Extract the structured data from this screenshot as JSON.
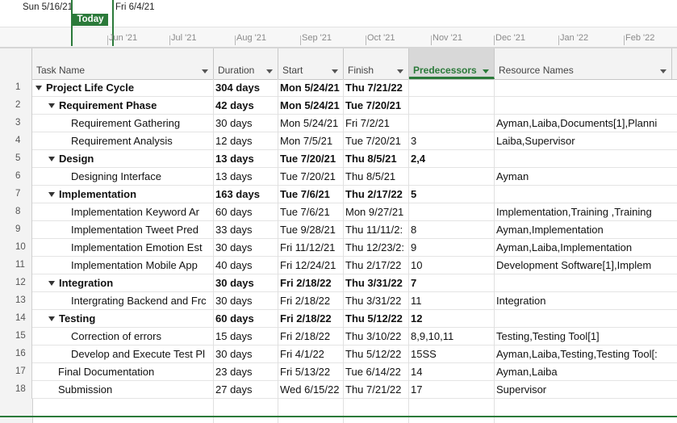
{
  "timeline": {
    "start_label": "Sun 5/16/21",
    "end_label": "Fri 6/4/21",
    "today_label": "Today",
    "months": [
      "Jun '21",
      "Jul '21",
      "Aug '21",
      "Sep '21",
      "Oct '21",
      "Nov '21",
      "Dec '21",
      "Jan '22",
      "Feb '22"
    ]
  },
  "columns": {
    "task_name": "Task Name",
    "duration": "Duration",
    "start": "Start",
    "finish": "Finish",
    "predecessors": "Predecessors",
    "resource_names": "Resource Names"
  },
  "accent_color": "#2b7a3a",
  "rows": [
    {
      "id": "1",
      "name": "Project Life Cycle",
      "level": 0,
      "summary": true,
      "duration": "304 days",
      "start": "Mon 5/24/21",
      "finish": "Thu 7/21/22",
      "pred": "",
      "res": ""
    },
    {
      "id": "2",
      "name": "Requirement Phase",
      "level": 1,
      "summary": true,
      "duration": "42 days",
      "start": "Mon 5/24/21",
      "finish": "Tue 7/20/21",
      "pred": "",
      "res": ""
    },
    {
      "id": "3",
      "name": "Requirement Gathering",
      "level": 2,
      "summary": false,
      "duration": "30 days",
      "start": "Mon 5/24/21",
      "finish": "Fri 7/2/21",
      "pred": "",
      "res": "Ayman,Laiba,Documents[1],Planni"
    },
    {
      "id": "4",
      "name": "Requirement Analysis",
      "level": 2,
      "summary": false,
      "duration": "12 days",
      "start": "Mon 7/5/21",
      "finish": "Tue 7/20/21",
      "pred": "3",
      "res": "Laiba,Supervisor"
    },
    {
      "id": "5",
      "name": "Design",
      "level": 1,
      "summary": true,
      "duration": "13 days",
      "start": "Tue 7/20/21",
      "finish": "Thu 8/5/21",
      "pred": "2,4",
      "res": ""
    },
    {
      "id": "6",
      "name": "Designing Interface",
      "level": 2,
      "summary": false,
      "duration": "13 days",
      "start": "Tue 7/20/21",
      "finish": "Thu 8/5/21",
      "pred": "",
      "res": "Ayman"
    },
    {
      "id": "7",
      "name": "Implementation",
      "level": 1,
      "summary": true,
      "duration": "163 days",
      "start": "Tue 7/6/21",
      "finish": "Thu 2/17/22",
      "pred": "5",
      "res": ""
    },
    {
      "id": "8",
      "name": "Implementation Keyword Ar",
      "level": 2,
      "summary": false,
      "duration": "60 days",
      "start": "Tue 7/6/21",
      "finish": "Mon 9/27/21",
      "pred": "",
      "res": "Implementation,Training ,Training"
    },
    {
      "id": "9",
      "name": "Implementation Tweet Pred",
      "level": 2,
      "summary": false,
      "duration": "33 days",
      "start": "Tue 9/28/21",
      "finish": "Thu 11/11/2:",
      "pred": "8",
      "res": "Ayman,Implementation"
    },
    {
      "id": "10",
      "name": "Implementation Emotion Est",
      "level": 2,
      "summary": false,
      "duration": "30 days",
      "start": "Fri 11/12/21",
      "finish": "Thu 12/23/2:",
      "pred": "9",
      "res": "Ayman,Laiba,Implementation"
    },
    {
      "id": "11",
      "name": "Implementation Mobile App",
      "level": 2,
      "summary": false,
      "duration": "40 days",
      "start": "Fri 12/24/21",
      "finish": "Thu 2/17/22",
      "pred": "10",
      "res": "Development Software[1],Implem"
    },
    {
      "id": "12",
      "name": "Integration",
      "level": 1,
      "summary": true,
      "duration": "30 days",
      "start": "Fri 2/18/22",
      "finish": "Thu 3/31/22",
      "pred": "7",
      "res": ""
    },
    {
      "id": "13",
      "name": "Intergrating Backend and Frc",
      "level": 2,
      "summary": false,
      "duration": "30 days",
      "start": "Fri 2/18/22",
      "finish": "Thu 3/31/22",
      "pred": "11",
      "res": "Integration"
    },
    {
      "id": "14",
      "name": "Testing",
      "level": 1,
      "summary": true,
      "duration": "60 days",
      "start": "Fri 2/18/22",
      "finish": "Thu 5/12/22",
      "pred": "12",
      "res": ""
    },
    {
      "id": "15",
      "name": "Correction of errors",
      "level": 2,
      "summary": false,
      "duration": "15 days",
      "start": "Fri 2/18/22",
      "finish": "Thu 3/10/22",
      "pred": "8,9,10,11",
      "res": "Testing,Testing Tool[1]"
    },
    {
      "id": "16",
      "name": "Develop and Execute Test Pl",
      "level": 2,
      "summary": false,
      "duration": "30 days",
      "start": "Fri 4/1/22",
      "finish": "Thu 5/12/22",
      "pred": "15SS",
      "res": "Ayman,Laiba,Testing,Testing Tool[:"
    },
    {
      "id": "17",
      "name": "Final Documentation",
      "level": 1,
      "summary": false,
      "duration": "23 days",
      "start": "Fri 5/13/22",
      "finish": "Tue 6/14/22",
      "pred": "14",
      "res": "Ayman,Laiba"
    },
    {
      "id": "18",
      "name": "Submission",
      "level": 1,
      "summary": false,
      "duration": "27 days",
      "start": "Wed 6/15/22",
      "finish": "Thu 7/21/22",
      "pred": "17",
      "res": "Supervisor"
    }
  ]
}
